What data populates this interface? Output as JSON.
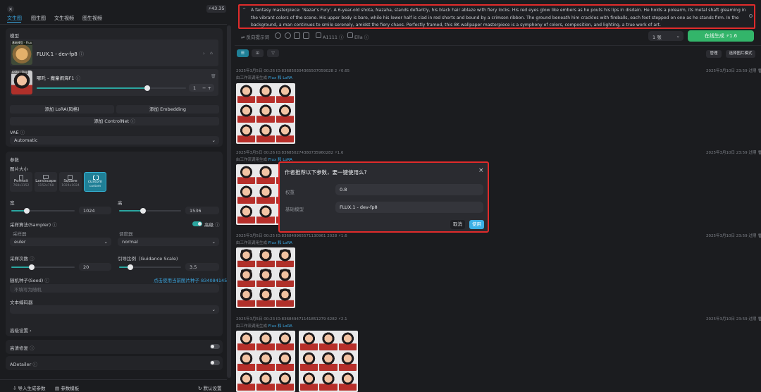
{
  "top": {
    "balance": "43.35"
  },
  "tabs": [
    "文生图",
    "图生图",
    "文生视频",
    "图生视频"
  ],
  "model_section": {
    "title": "模型",
    "base_thumb_tag": "基础模型 · Flux",
    "base_model_name": "FLUX.1 - dev-fp8",
    "lora_thumb_tag": "LoRA · Flux",
    "lora_name": "哪吒 - 魔童闹海F1",
    "lora_weight": "1",
    "add_lora": "添加 LoRA(风格)",
    "add_embedding": "添加 Embedding",
    "add_controlnet": "添加 ControlNet",
    "vae_label": "VAE",
    "vae_value": "Automatic"
  },
  "params": {
    "title": "参数",
    "image_size_label": "图片大小",
    "sizes": [
      {
        "name": "Portrait",
        "dims": "768x1152"
      },
      {
        "name": "Landscape",
        "dims": "1152x768"
      },
      {
        "name": "Square",
        "dims": "1024x1024"
      },
      {
        "name": "custom",
        "dims": "custom"
      }
    ],
    "width_label": "宽",
    "width_value": "1024",
    "height_label": "高",
    "height_value": "1536",
    "sampler_label": "采样算法(Sampler)",
    "advanced_label": "高级",
    "sampler_sub": "采样器",
    "sampler_value": "euler",
    "scheduler_sub": "调度器",
    "scheduler_value": "normal",
    "steps_label": "采样次数",
    "steps_value": "20",
    "cfg_label": "引导比例（Guidance Scale)",
    "cfg_value": "3.5",
    "seed_label": "随机种子(Seed)",
    "seed_link": "点击使用当前图片种子 834084145",
    "seed_placeholder": "不填写为随机",
    "text_enc_label": "文本编码器",
    "advanced_settings": "高级设置",
    "hires_label": "高清修复",
    "adetailer_label": "ADetailer"
  },
  "bottom": {
    "import": "导入生成参数",
    "params": "参数模板",
    "reset": "默认设置"
  },
  "prompt": {
    "text": "A fantasy masterpiece: 'Nazar's Fury'. A 6-year-old shota, Nazaha, stands defiantly, his black hair ablaze with fiery locks. His red eyes glow like embers as he pouts his lips in disdain. He holds a polearm, its metal shaft gleaming in the vibrant colors of the scene. His upper body is bare, while his lower half is clad in red shorts and bound by a crimson ribbon. The ground beneath him crackles with fireballs, each foot stepped on one as he stands firm. In the background, a man continues to smile serenely, amidst the fiery chaos. Perfectly framed, this 8K wallpaper masterpiece is a symphony of colors, composition, and lighting, a true work of art."
  },
  "toolbar": {
    "neg_prompt": "反向提示词",
    "a1111": "A1111",
    "ella": "Ella",
    "count": "1 张",
    "generate": "在线生成",
    "cost": "1.6",
    "manage": "管理",
    "select_mode": "选择图片模式"
  },
  "entries": [
    {
      "header": "2025年3月5日 00:26 ID:836850304365507059028 2  ⚡0.65",
      "sub": "由工作流调用生成",
      "tag": "Flux 和 LoRA",
      "date": "2025年3月10日 23:59 过期"
    },
    {
      "header": "2025年3月5日 00:26 ID:836850274380735960282  ⚡1.6",
      "sub": "由工作流调用生成",
      "tag": "Flux 和 LoRA",
      "date": "2025年3月10日 23:59 过期"
    },
    {
      "header": "2025年3月5日 00:25 ID:836849965571130961 2028  ⚡1.6",
      "sub": "由工作流调用生成",
      "tag": "Flux 和 LoRA",
      "date": "2025年3月10日 23:59 过期"
    },
    {
      "header": "2025年3月5日 00:23 ID:836849471141851279 6282  ⚡2.1",
      "sub": "由工作流调用生成",
      "tag": "Flux 和 LoRA",
      "date": "2025年3月10日 23:59 过期"
    }
  ],
  "modal": {
    "title": "作者推荐以下参数，要一键使用么?",
    "weight_label": "权重",
    "weight_value": "0.8",
    "base_label": "基础模型",
    "base_value": "FLUX.1 - dev-fp8",
    "cancel": "取消",
    "apply": "使用"
  }
}
